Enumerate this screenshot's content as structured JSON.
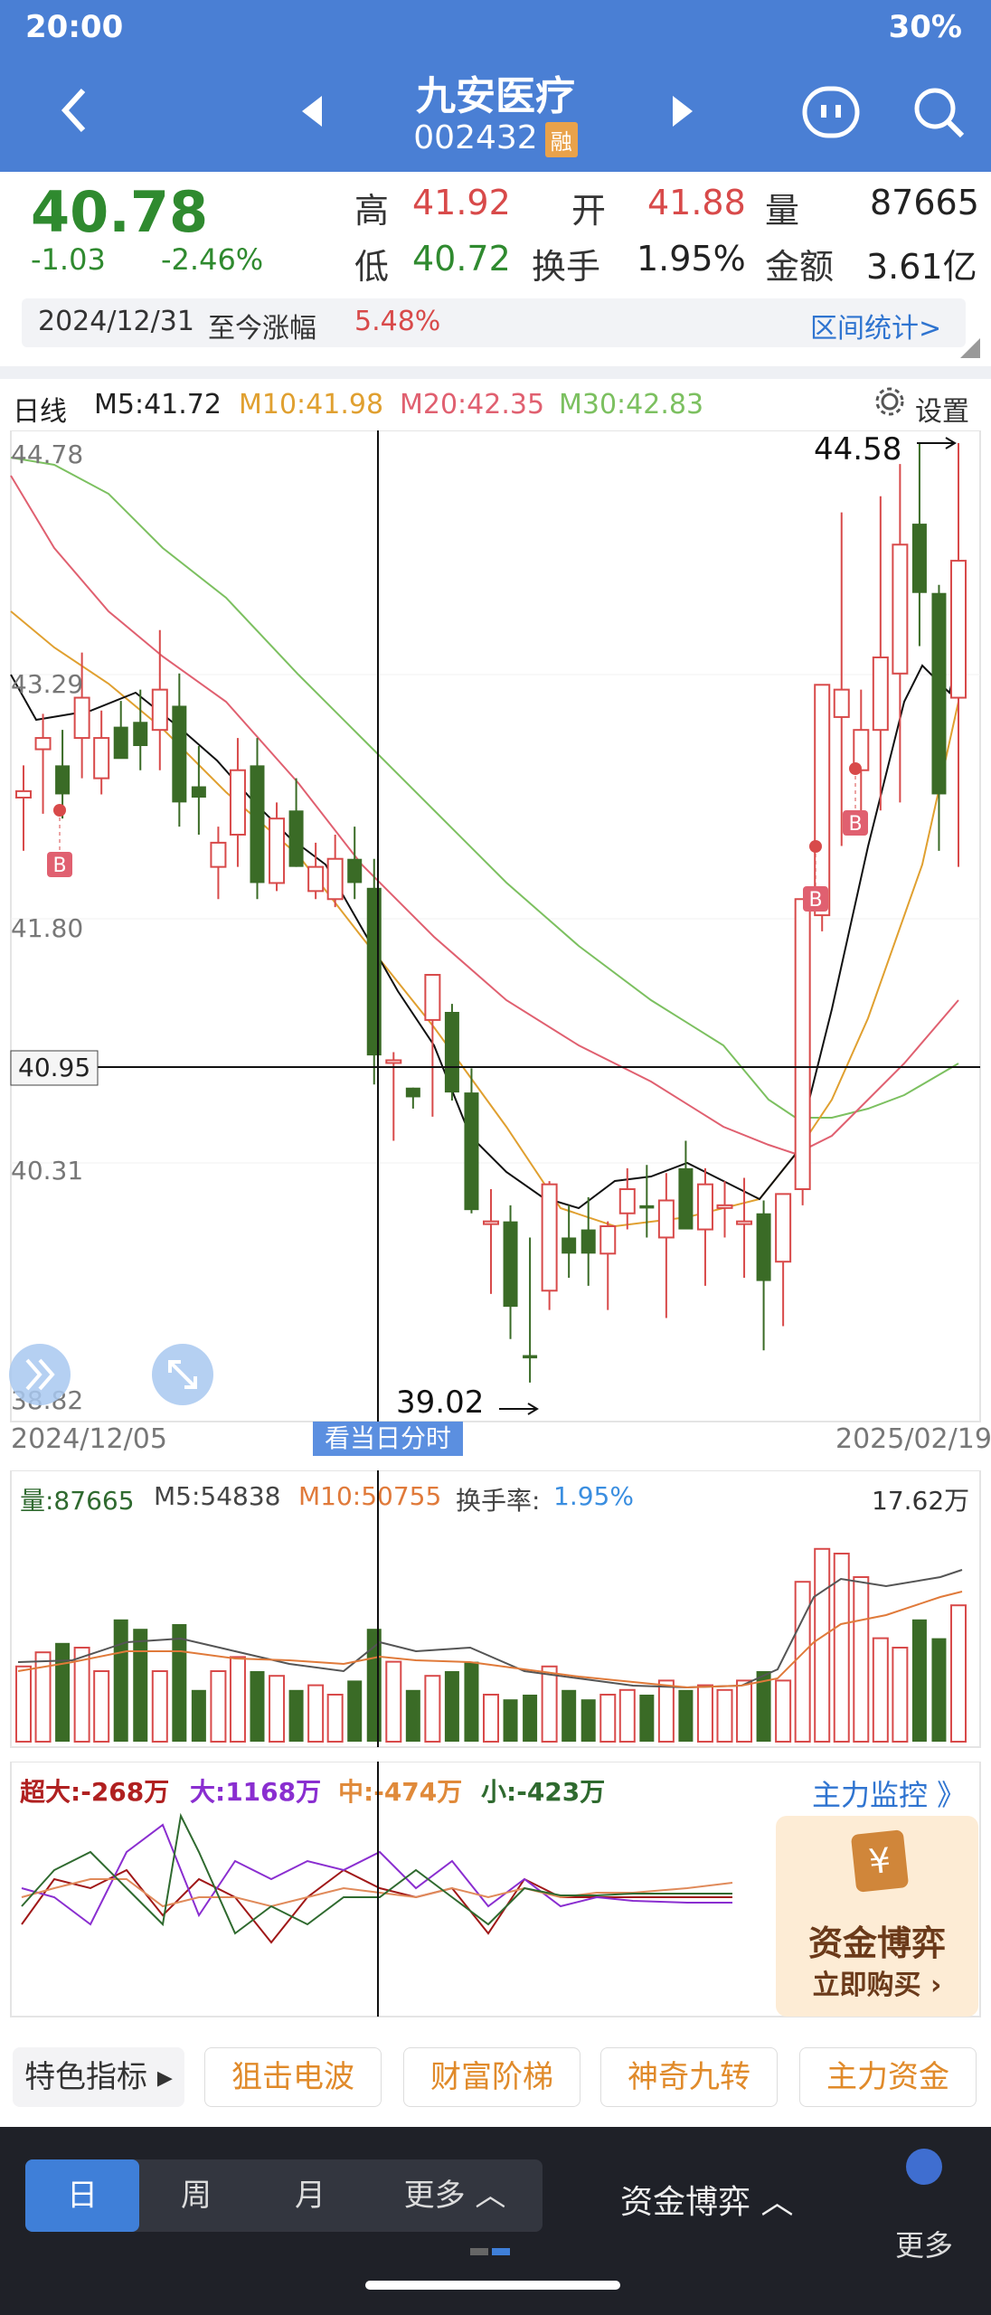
{
  "status": {
    "time": "20:00",
    "battery": "30%"
  },
  "nav": {
    "title": "九安医疗",
    "code": "002432",
    "badge": "融",
    "back_icon": "chevron-left-icon",
    "prev_icon": "triangle-left-icon",
    "next_icon": "triangle-right-icon",
    "chat_icon": "smiley-chat-icon",
    "search_icon": "search-icon"
  },
  "quote": {
    "price": "40.78",
    "change": "-1.03",
    "change_pct": "-2.46%",
    "high_label": "高",
    "high": "41.92",
    "open_label": "开",
    "open": "41.88",
    "vol_label": "量",
    "vol": "87665",
    "low_label": "低",
    "low": "40.72",
    "turnover_label": "换手",
    "turnover": "1.95%",
    "amount_label": "金额",
    "amount": "3.61亿"
  },
  "range": {
    "date": "2024/12/31",
    "label": "至今涨幅",
    "pct": "5.48%",
    "link": "区间统计>"
  },
  "kline": {
    "period": "日线",
    "m5": "M5:41.72",
    "m10": "M10:41.98",
    "m20": "M20:42.35",
    "m30": "M30:42.83",
    "settings": "设置",
    "y_top": "44.78",
    "y1": "43.29",
    "y2": "41.80",
    "cross": "40.95",
    "y3": "40.31",
    "y_bot": "38.82",
    "max_label": "44.58",
    "min_label": "39.02",
    "date_start": "2024/12/05",
    "date_end": "2025/02/19",
    "intraday_btn": "看当日分时",
    "colors": {
      "m5": "#111111",
      "m10": "#e0a030",
      "m20": "#e06070",
      "m30": "#7cc060",
      "up": "#d84a4a",
      "down": "#3a6b26"
    }
  },
  "volume": {
    "label": "量:87665",
    "m5": "M5:54838",
    "m10": "M10:50755",
    "rate_label": "换手率:",
    "rate": "1.95%",
    "max": "17.62万"
  },
  "flow": {
    "xl": "超大:-268万",
    "l": "大:1168万",
    "m": "中:-474万",
    "s": "小:-423万",
    "monitor": "主力监控 》",
    "ad_title": "资金博弈",
    "ad_btn": "立即购买 ›"
  },
  "tabs": {
    "special": "特色指标 ▸",
    "t1": "狙击电波",
    "t2": "财富阶梯",
    "t3": "神奇九转",
    "t4": "主力资金"
  },
  "bottom": {
    "day": "日",
    "week": "周",
    "month": "月",
    "more": "更多 ︿",
    "game": "资金博弈 ︿",
    "more2": "更多"
  },
  "chart_data": {
    "type": "candlestick",
    "x_range": [
      "2024/12/05",
      "2025/02/19"
    ],
    "ylim": [
      38.82,
      44.78
    ],
    "high_marker": 44.58,
    "low_marker": 39.02,
    "candles": [
      [
        42.58,
        42.78,
        42.25,
        42.62
      ],
      [
        42.88,
        43.1,
        42.48,
        42.95
      ],
      [
        42.78,
        43.0,
        42.45,
        42.6
      ],
      [
        42.95,
        43.48,
        42.7,
        43.2
      ],
      [
        42.7,
        43.12,
        42.6,
        42.95
      ],
      [
        43.02,
        43.18,
        42.85,
        42.82
      ],
      [
        43.05,
        43.25,
        42.75,
        42.9
      ],
      [
        43.0,
        43.62,
        42.75,
        43.25
      ],
      [
        43.15,
        43.35,
        42.4,
        42.55
      ],
      [
        42.65,
        42.9,
        42.35,
        42.58
      ],
      [
        42.15,
        42.4,
        41.95,
        42.3
      ],
      [
        42.35,
        42.95,
        42.15,
        42.75
      ],
      [
        42.78,
        42.95,
        41.95,
        42.05
      ],
      [
        42.05,
        42.55,
        42.0,
        42.45
      ],
      [
        42.5,
        42.7,
        42.15,
        42.15
      ],
      [
        42.0,
        42.3,
        41.95,
        42.15
      ],
      [
        41.95,
        42.35,
        41.9,
        42.2
      ],
      [
        42.2,
        42.4,
        41.95,
        42.05
      ],
      [
        42.02,
        42.2,
        40.8,
        40.98
      ],
      [
        40.95,
        41.0,
        40.45,
        40.95
      ],
      [
        40.78,
        40.78,
        40.65,
        40.72
      ],
      [
        41.2,
        41.48,
        40.6,
        41.48
      ],
      [
        41.25,
        41.3,
        40.7,
        40.75
      ],
      [
        40.75,
        40.9,
        40.0,
        40.02
      ],
      [
        39.95,
        40.15,
        39.5,
        39.95
      ],
      [
        39.95,
        40.05,
        39.22,
        39.42
      ],
      [
        39.12,
        39.85,
        38.95,
        39.1
      ],
      [
        39.52,
        40.2,
        39.4,
        40.18
      ],
      [
        39.85,
        40.05,
        39.6,
        39.75
      ],
      [
        39.9,
        40.1,
        39.55,
        39.75
      ],
      [
        39.75,
        39.95,
        39.4,
        39.92
      ],
      [
        40.0,
        40.28,
        39.9,
        40.15
      ],
      [
        40.05,
        40.3,
        39.85,
        40.03
      ],
      [
        39.85,
        40.25,
        39.35,
        40.08
      ],
      [
        40.28,
        40.45,
        39.95,
        39.9
      ],
      [
        39.9,
        40.28,
        39.55,
        40.18
      ],
      [
        40.05,
        40.2,
        39.85,
        40.05
      ],
      [
        39.95,
        40.22,
        39.6,
        39.95
      ],
      [
        40.0,
        40.08,
        39.15,
        39.58
      ],
      [
        39.7,
        40.1,
        39.3,
        40.12
      ],
      [
        40.15,
        41.95,
        40.05,
        41.95
      ],
      [
        41.85,
        43.28,
        41.75,
        43.28
      ],
      [
        43.08,
        44.35,
        42.28,
        43.25
      ],
      [
        42.75,
        43.25,
        42.35,
        43.0
      ],
      [
        43.0,
        44.45,
        42.5,
        43.45
      ],
      [
        43.35,
        44.65,
        42.55,
        44.15
      ],
      [
        44.28,
        44.78,
        43.52,
        43.85
      ],
      [
        43.85,
        43.9,
        42.25,
        42.6
      ],
      [
        43.2,
        44.78,
        42.15,
        44.05
      ]
    ]
  }
}
